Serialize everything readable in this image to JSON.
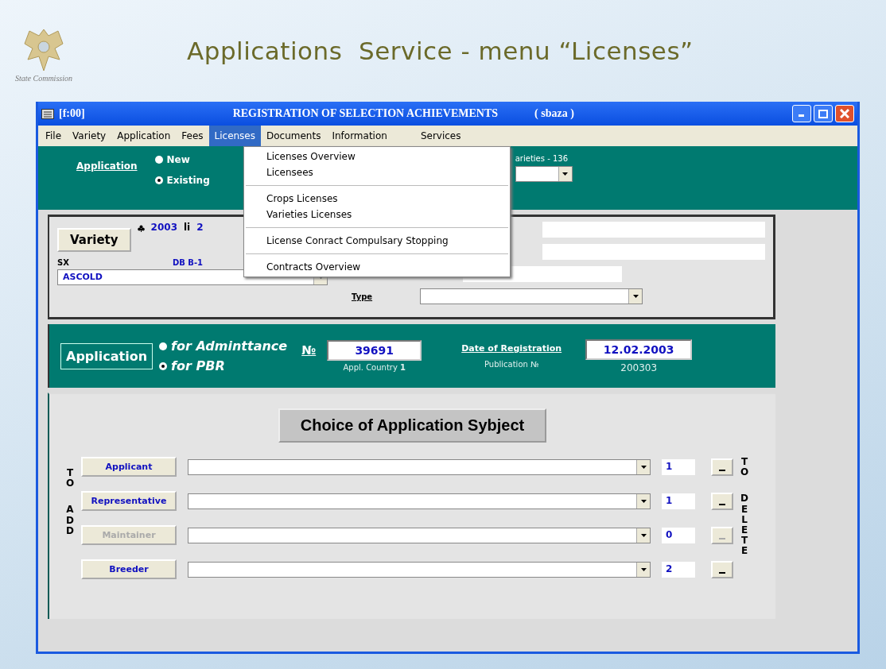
{
  "slide": {
    "title": "Applications  Service - menu “Licenses”",
    "logo_caption": "State Commission"
  },
  "window": {
    "id_label": "[f:00]",
    "title": "REGISTRATION OF SELECTION ACHIEVEMENTS",
    "user": "( sbaza )"
  },
  "menu": [
    {
      "label": "File",
      "selected": false
    },
    {
      "label": "Variety",
      "selected": false
    },
    {
      "label": "Application",
      "selected": false
    },
    {
      "label": "Fees",
      "selected": false
    },
    {
      "label": "Licenses",
      "selected": true
    },
    {
      "label": "Documents",
      "selected": false
    },
    {
      "label": "Information",
      "selected": false
    },
    {
      "label": "Services",
      "selected": false
    }
  ],
  "dropdown": [
    [
      "Licenses Overview",
      "Licensees"
    ],
    [
      "Crops Licenses",
      "Varieties  Licenses"
    ],
    [
      "License  Conract Compulsary Stopping"
    ],
    [
      "Contracts Overview"
    ]
  ],
  "top_bar": {
    "link": "Application",
    "radios": [
      {
        "label": "New",
        "selected": false
      },
      {
        "label": "Existing",
        "selected": true
      }
    ],
    "varieties_label": "arieties - 136"
  },
  "variety": {
    "button": "Variety",
    "year": "2003",
    "li_label": "li",
    "cut_value": "2",
    "sx_label": "SX",
    "code": "DB B-1",
    "name_value": "ASCOLD",
    "type_link": "Type"
  },
  "application": {
    "button": "Application",
    "radios": [
      {
        "label": "for Adminttance",
        "selected": false
      },
      {
        "label": "for PBR",
        "selected": true
      }
    ],
    "number_link": "№",
    "number": "39691",
    "country_label": "Appl. Country",
    "country": "1",
    "date_link": "Date of Registration",
    "date": "12.02.2003",
    "publication_label": "Publication  №",
    "publication": "200303"
  },
  "choice": {
    "title": "Choice of Application Sybject",
    "add_words": [
      "TO",
      "ADD"
    ],
    "delete_words": [
      "TO",
      "DELETE"
    ],
    "rows": [
      {
        "label": "Applicant",
        "disabled": false,
        "count": "1"
      },
      {
        "label": "Representative",
        "disabled": false,
        "count": "1"
      },
      {
        "label": "Maintainer",
        "disabled": true,
        "count": "0"
      },
      {
        "label": "Breeder",
        "disabled": false,
        "count": "2"
      }
    ]
  }
}
